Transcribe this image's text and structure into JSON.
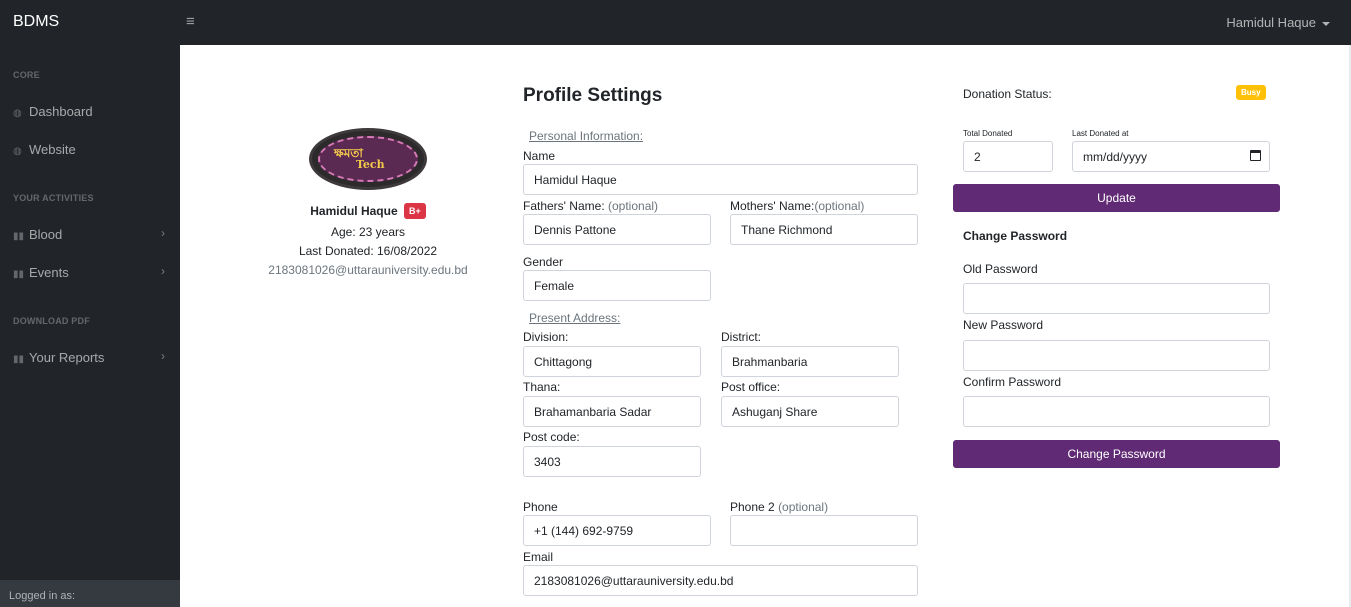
{
  "topbar": {
    "brand": "BDMS",
    "toggle_glyph": "≡",
    "user_name": "Hamidul Haque"
  },
  "sidebar": {
    "headings": [
      "CORE",
      "YOUR ACTIVITIES",
      "DOWNLOAD PDF"
    ],
    "items": [
      {
        "label": "Dashboard",
        "icon": "palette-icon"
      },
      {
        "label": "Website",
        "icon": "palette-icon"
      },
      {
        "label": "Blood",
        "icon": "book-icon",
        "has_children": true
      },
      {
        "label": "Events",
        "icon": "book-icon",
        "has_children": true
      },
      {
        "label": "Your Reports",
        "icon": "book-icon",
        "has_children": true
      }
    ],
    "footer": "Logged in as:"
  },
  "profile": {
    "logo_text_1": "ক্ষমতা",
    "logo_text_2": "Tech",
    "name": "Hamidul Haque",
    "blood_group": "B+",
    "age": "Age: 23 years",
    "last_donated": "Last Donated: 16/08/2022",
    "email": "2183081026@uttarauniversity.edu.bd"
  },
  "form": {
    "title": "Profile Settings",
    "personal_info_label": "Personal Information:",
    "name_label": "Name",
    "name_value": "Hamidul Haque",
    "fathers_label": "Fathers' Name:",
    "fathers_optional": "(optional)",
    "fathers_value": "Dennis Pattone",
    "mothers_label": "Mothers' Name:",
    "mothers_optional": "(optional)",
    "mothers_value": "Thane Richmond",
    "gender_label": "Gender",
    "gender_value": "Female",
    "present_address_label": "Present Address:",
    "division_label": "Division:",
    "division_value": "Chittagong",
    "district_label": "District:",
    "district_value": "Brahmanbaria",
    "thana_label": "Thana:",
    "thana_value": "Brahamanbaria Sadar",
    "post_office_label": "Post office:",
    "post_office_value": "Ashuganj Share",
    "post_code_label": "Post code:",
    "post_code_value": "3403",
    "phone_label": "Phone",
    "phone_value": "+1 (144) 692-9759",
    "phone2_label": "Phone 2",
    "phone2_optional": "(optional)",
    "phone2_value": "",
    "email_label": "Email",
    "email_value": "2183081026@uttarauniversity.edu.bd"
  },
  "donation": {
    "status_label": "Donation Status:",
    "status_value": "Busy",
    "status_color": "#ffc107",
    "total_label": "Total Donated",
    "total_value": "2",
    "last_label": "Last Donated at",
    "last_placeholder": "mm/dd/yyyy",
    "update_button": "Update"
  },
  "password": {
    "title": "Change Password",
    "old_label": "Old Password",
    "new_label": "New Password",
    "confirm_label": "Confirm Password",
    "button": "Change Password"
  },
  "colors": {
    "sidebar_bg": "#212529",
    "accent_purple": "#612a74",
    "badge_red": "#dc3545"
  }
}
